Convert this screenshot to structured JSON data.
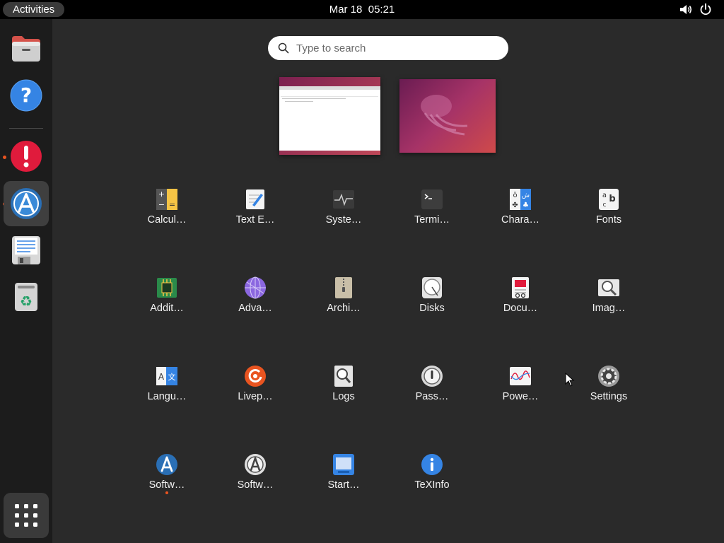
{
  "topbar": {
    "activities_label": "Activities",
    "clock": "Mar 18  05:21",
    "icons": [
      "volume-icon",
      "power-icon"
    ]
  },
  "dock": {
    "items": [
      {
        "name": "files",
        "icon": "folder-icon"
      },
      {
        "name": "help",
        "icon": "help-icon"
      },
      {
        "name": "update-notifier",
        "icon": "exclamation-icon",
        "running": true
      },
      {
        "name": "software",
        "icon": "software-icon",
        "running": true,
        "active": true
      },
      {
        "name": "save-document",
        "icon": "floppy-document-icon"
      },
      {
        "name": "trash",
        "icon": "trash-icon"
      }
    ],
    "show_apps_icon": "grid-icon"
  },
  "search": {
    "placeholder": "Type to search"
  },
  "workspaces": [
    {
      "name": "workspace-1",
      "has_window": true
    },
    {
      "name": "workspace-2",
      "has_window": false
    }
  ],
  "apps": [
    {
      "label": "Calcul…",
      "icon": "calculator-icon"
    },
    {
      "label": "Text E…",
      "icon": "text-editor-icon"
    },
    {
      "label": "Syste…",
      "icon": "system-monitor-icon"
    },
    {
      "label": "Termi…",
      "icon": "terminal-icon"
    },
    {
      "label": "Chara…",
      "icon": "characters-icon"
    },
    {
      "label": "Fonts",
      "icon": "fonts-icon"
    },
    {
      "label": "Addit…",
      "icon": "additional-drivers-icon"
    },
    {
      "label": "Adva…",
      "icon": "advanced-network-icon"
    },
    {
      "label": "Archi…",
      "icon": "archive-manager-icon"
    },
    {
      "label": "Disks",
      "icon": "disks-icon"
    },
    {
      "label": "Docu…",
      "icon": "document-viewer-icon"
    },
    {
      "label": "Imag…",
      "icon": "image-viewer-icon"
    },
    {
      "label": "Langu…",
      "icon": "language-icon"
    },
    {
      "label": "Livep…",
      "icon": "livepatch-icon"
    },
    {
      "label": "Logs",
      "icon": "logs-icon"
    },
    {
      "label": "Pass…",
      "icon": "passwords-icon"
    },
    {
      "label": "Powe…",
      "icon": "power-statistics-icon"
    },
    {
      "label": "Settings",
      "icon": "settings-icon"
    },
    {
      "label": "Softw…",
      "icon": "software-icon",
      "running": true
    },
    {
      "label": "Softw…",
      "icon": "software-updater-icon"
    },
    {
      "label": "Start…",
      "icon": "startup-disk-icon"
    },
    {
      "label": "TeXInfo",
      "icon": "info-icon"
    }
  ],
  "colors": {
    "accent": "#e95420",
    "background": "#2a2a2a",
    "topbar": "#000000",
    "dock": "#1c1c1c"
  }
}
